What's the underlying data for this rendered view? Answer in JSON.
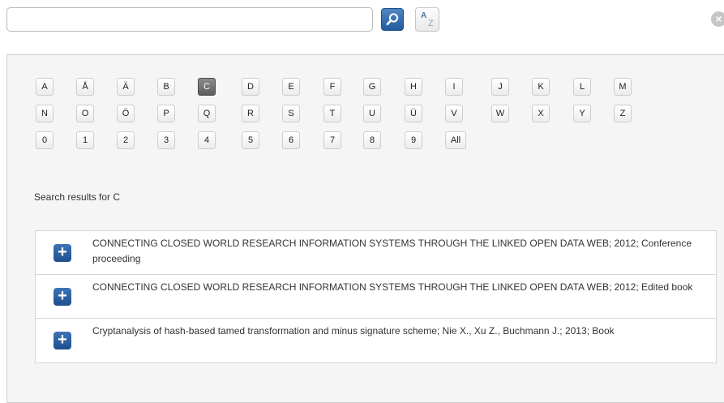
{
  "search": {
    "value": "",
    "placeholder": ""
  },
  "toolbar": {
    "sort_a": "A",
    "sort_z": "Z",
    "close_symbol": "×"
  },
  "alphabet": {
    "row1": [
      "A",
      "Å",
      "Ä",
      "B",
      "C",
      "D",
      "E",
      "F",
      "G",
      "H",
      "I",
      "J",
      "K",
      "L",
      "M"
    ],
    "row2": [
      "N",
      "O",
      "Ö",
      "P",
      "Q",
      "R",
      "S",
      "T",
      "U",
      "Ü",
      "V",
      "W",
      "X",
      "Y",
      "Z"
    ],
    "row3": [
      "0",
      "1",
      "2",
      "3",
      "4",
      "5",
      "6",
      "7",
      "8",
      "9",
      "All"
    ],
    "selected": "C"
  },
  "results": {
    "title": "Search results for C",
    "items": [
      {
        "text": "CONNECTING CLOSED WORLD RESEARCH INFORMATION SYSTEMS THROUGH THE LINKED OPEN DATA WEB; 2012; Conference proceeding"
      },
      {
        "text": "CONNECTING CLOSED WORLD RESEARCH INFORMATION SYSTEMS THROUGH THE LINKED OPEN DATA WEB; 2012; Edited book"
      },
      {
        "text": "Cryptanalysis of hash-based tamed transformation and minus signature scheme; Nie X., Xu Z., Buchmann J.; 2013; Book"
      }
    ],
    "expand_symbol": "+"
  },
  "icons": {
    "search": "search-icon",
    "sort": "sort-az-icon",
    "close": "close-icon",
    "expand": "plus-icon"
  },
  "colors": {
    "accent": "#2f66a8",
    "selected_letter": "#6f6f6f"
  }
}
